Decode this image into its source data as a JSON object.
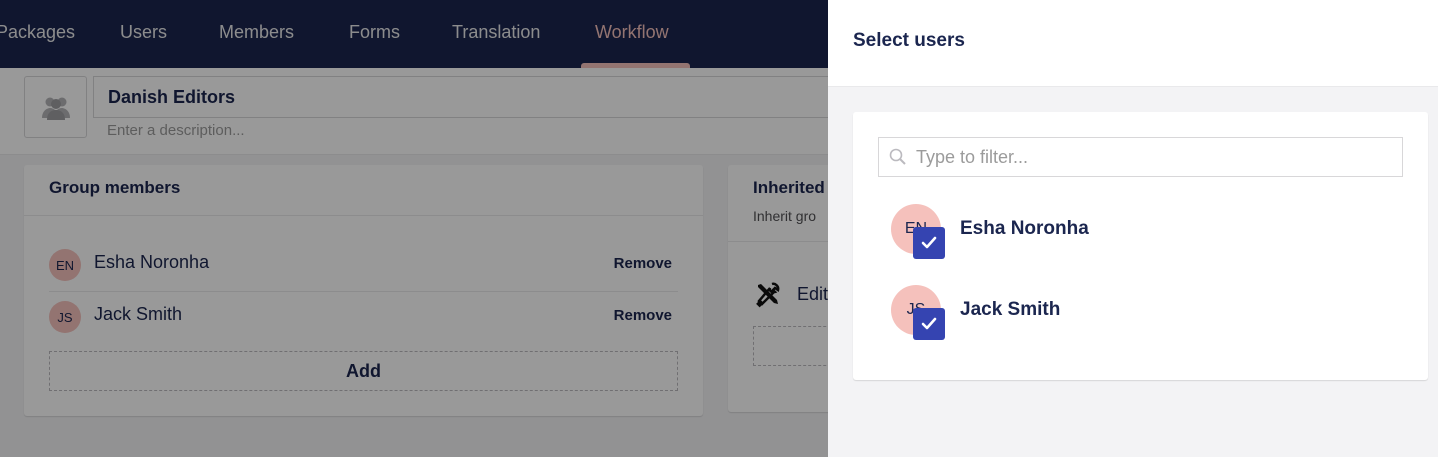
{
  "nav": {
    "items": [
      {
        "label": "Packages"
      },
      {
        "label": "Users"
      },
      {
        "label": "Members"
      },
      {
        "label": "Forms"
      },
      {
        "label": "Translation"
      },
      {
        "label": "Workflow",
        "active": true
      }
    ]
  },
  "group": {
    "name": "Danish Editors",
    "description_placeholder": "Enter a description..."
  },
  "members_card": {
    "title": "Group members",
    "members": [
      {
        "initials": "EN",
        "name": "Esha Noronha",
        "action": "Remove"
      },
      {
        "initials": "JS",
        "name": "Jack Smith",
        "action": "Remove"
      }
    ],
    "add_label": "Add"
  },
  "inherited_card": {
    "title": "Inherited",
    "subtitle": "Inherit gro",
    "edit_label": "Edit"
  },
  "panel": {
    "title": "Select users",
    "filter_placeholder": "Type to filter...",
    "users": [
      {
        "initials": "EN",
        "name": "Esha Noronha",
        "selected": true
      },
      {
        "initials": "JS",
        "name": "Jack Smith",
        "selected": true
      }
    ]
  },
  "colors": {
    "nav_bg": "#1b264f",
    "accent": "#f5c1bc",
    "checkbox": "#3544b1",
    "text": "#1b264f"
  }
}
